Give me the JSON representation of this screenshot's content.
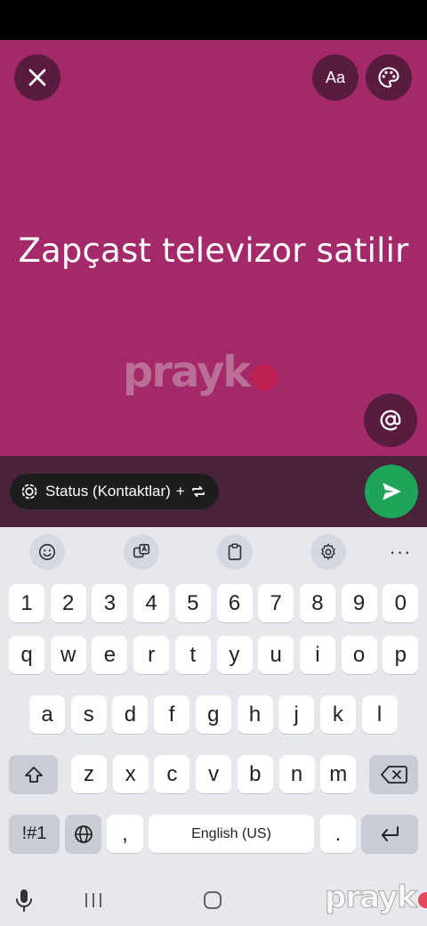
{
  "status_text": "Zapçast televizor satilir",
  "header": {
    "font_label": "Aa"
  },
  "watermark": {
    "text": "prayk"
  },
  "compose": {
    "audience_label": "Status (Kontaktlar)",
    "audience_plus": "+"
  },
  "keyboard": {
    "rows": {
      "numbers": [
        "1",
        "2",
        "3",
        "4",
        "5",
        "6",
        "7",
        "8",
        "9",
        "0"
      ],
      "row1": [
        "q",
        "w",
        "e",
        "r",
        "t",
        "y",
        "u",
        "i",
        "o",
        "p"
      ],
      "row2": [
        "a",
        "s",
        "d",
        "f",
        "g",
        "h",
        "j",
        "k",
        "l"
      ],
      "row3": [
        "z",
        "x",
        "c",
        "v",
        "b",
        "n",
        "m"
      ]
    },
    "symbols_label": "!#1",
    "comma": ",",
    "space_label": "English (US)",
    "period": "."
  },
  "colors": {
    "canvas": "#a3296b",
    "send": "#1ea55a"
  },
  "icons": [
    "close-icon",
    "text-font-icon",
    "palette-icon",
    "at-sign-icon",
    "status-icon",
    "repeat-icon",
    "send-icon",
    "emoji-icon",
    "translate-icon",
    "clipboard-icon",
    "settings-icon",
    "more-icon",
    "shift-icon",
    "backspace-icon",
    "globe-icon",
    "enter-icon",
    "microphone-icon",
    "recent-apps-icon",
    "home-icon"
  ]
}
